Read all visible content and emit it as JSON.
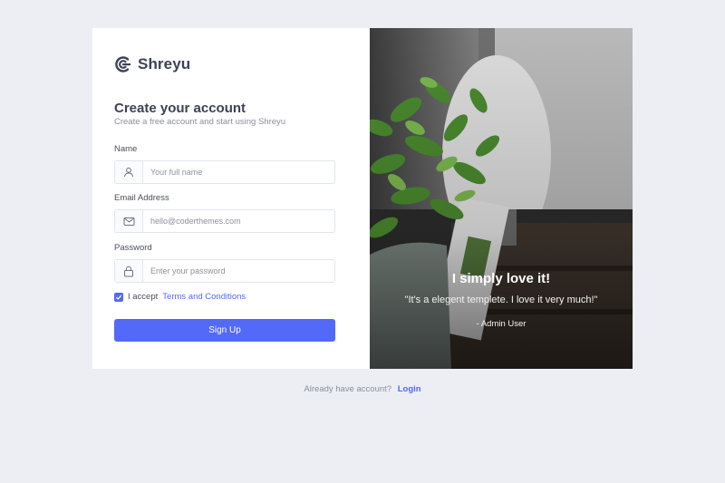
{
  "brand": {
    "name": "Shreyu",
    "icon": "shreyu-logo-icon"
  },
  "form": {
    "title": "Create your account",
    "subtitle": "Create a free account and start using Shreyu",
    "name_label": "Name",
    "name_placeholder": "Your full name",
    "email_label": "Email Address",
    "email_placeholder": "hello@coderthemes.com",
    "password_label": "Password",
    "password_placeholder": "Enter your password",
    "accept_text": "I accept",
    "terms_link": "Terms and Conditions",
    "terms_checked": true,
    "submit_label": "Sign Up"
  },
  "testimonial": {
    "title": "I simply love it!",
    "quote": "\"It's a elegent templete. I love it very much!\"",
    "author": "- Admin User"
  },
  "footer": {
    "text": "Already have account?",
    "login_link": "Login"
  },
  "colors": {
    "accent": "#5369f8",
    "background": "#eceef3"
  }
}
